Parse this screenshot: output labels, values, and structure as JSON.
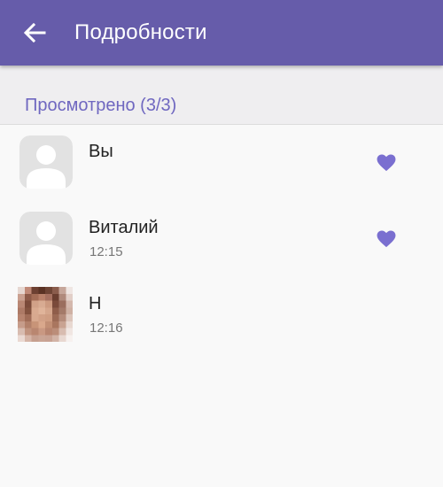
{
  "header": {
    "title": "Подробности",
    "back_icon": "arrow-left-icon"
  },
  "section": {
    "title": "Просмотрено (3/3)"
  },
  "colors": {
    "appbar": "#665caa",
    "accent": "#7a6fd0",
    "section_text": "#6f67c0"
  },
  "viewers": [
    {
      "name": "Вы",
      "time": "",
      "liked": true,
      "avatar": "default-avatar-icon"
    },
    {
      "name": "Виталий",
      "time": "12:15",
      "liked": true,
      "avatar": "default-avatar-icon"
    },
    {
      "name": "Н",
      "time": "12:16",
      "liked": false,
      "avatar": "photo-avatar"
    }
  ]
}
